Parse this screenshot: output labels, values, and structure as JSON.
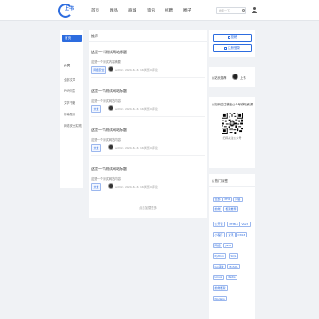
{
  "brand": {
    "logo_text": "上书"
  },
  "nav": [
    "首页",
    "精品",
    "商城",
    "资讯",
    "招聘",
    "圈子"
  ],
  "search": {
    "placeholder": "搜索一下"
  },
  "leftnav": {
    "active": "首页",
    "section": "分类",
    "items": [
      "全部文章",
      "PHP问答",
      "文学书籍",
      "前端框架",
      "网络安全实践"
    ]
  },
  "main": {
    "title": "推荐",
    "posts": [
      {
        "title": "这是一个测试网站标题",
        "sub": "这是一个测试内容摘要",
        "tag": "网络安全",
        "author": "admin",
        "date": "2024-6-16",
        "views": "16 浏览",
        "comments": "0 评论"
      },
      {
        "title": "这是一个测试网站标题",
        "sub": "这是一个测试网站内容",
        "tag": "文章",
        "author": "admin",
        "date": "2024-6-16",
        "views": "16 浏览",
        "comments": "0 评论"
      },
      {
        "title": "这是一个测试网站标题",
        "sub": "这是一个测试网站内容",
        "tag": "文章",
        "author": "admin",
        "date": "2024-6-16",
        "views": "16 浏览",
        "comments": "0 评论"
      },
      {
        "title": "这是一个测试网站标题",
        "sub": "这是一个测试网站内容",
        "tag": "文章",
        "author": "admin",
        "date": "2024-6-16",
        "views": "16 浏览",
        "comments": "0 评论"
      }
    ],
    "load_more": "点击加载更多"
  },
  "side": {
    "btn_publish": "投稿",
    "btn_register": "注册登录",
    "user_label": "// 站长推荐",
    "user_name": "上书",
    "qr_title": "// 扫码关注微信公众号获取资源",
    "qr_caption": "扫码关注公众号",
    "tags_title": "// 热门标签",
    "tags": [
      "全部",
      "PHP",
      "问答",
      "前端",
      "框架推荐",
      "公开课",
      "HTML5",
      "Vue3",
      "小程序",
      "资讯",
      "CSS3",
      "网络",
      "Java",
      "Python",
      "SQL",
      "Go语言",
      "MySQL",
      "Linux",
      "Redis",
      "前端框架",
      "Node.js"
    ]
  }
}
